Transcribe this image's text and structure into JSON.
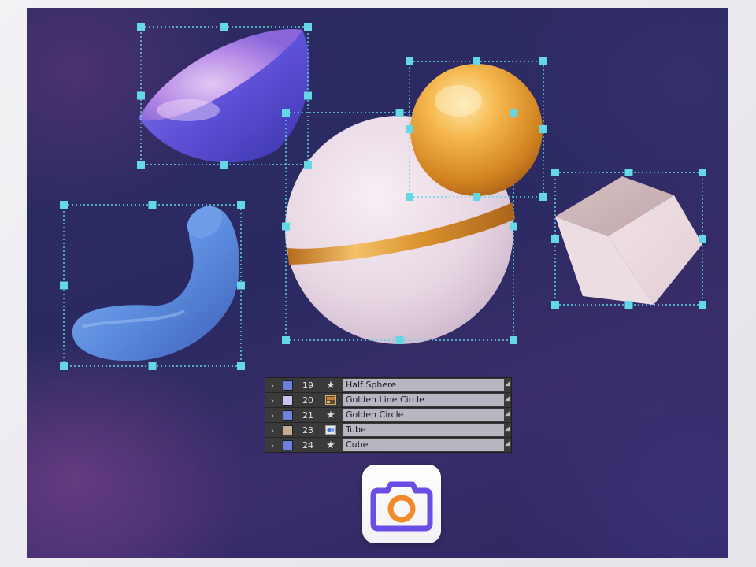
{
  "layers": [
    {
      "number": "19",
      "name": "Half Sphere",
      "label_color": "#6f7fdd",
      "type_icon": "star-icon",
      "type_glyph": "★"
    },
    {
      "number": "20",
      "name": "Golden Line Circle",
      "label_color": "#c7c6ee",
      "type_icon": "image-icon",
      "type_glyph": ""
    },
    {
      "number": "21",
      "name": "Golden Circle",
      "label_color": "#6f7fdd",
      "type_icon": "star-icon",
      "type_glyph": "★"
    },
    {
      "number": "23",
      "name": "Tube",
      "label_color": "#c4ac96",
      "type_icon": "image-icon",
      "type_glyph": ""
    },
    {
      "number": "24",
      "name": "Cube",
      "label_color": "#6f7fdd",
      "type_icon": "star-icon",
      "type_glyph": "★"
    }
  ],
  "colors": {
    "selection": "#65d8e6",
    "camera_purple": "#6b4de6",
    "camera_orange": "#f08a2a"
  },
  "app_icon": "camera-icon"
}
